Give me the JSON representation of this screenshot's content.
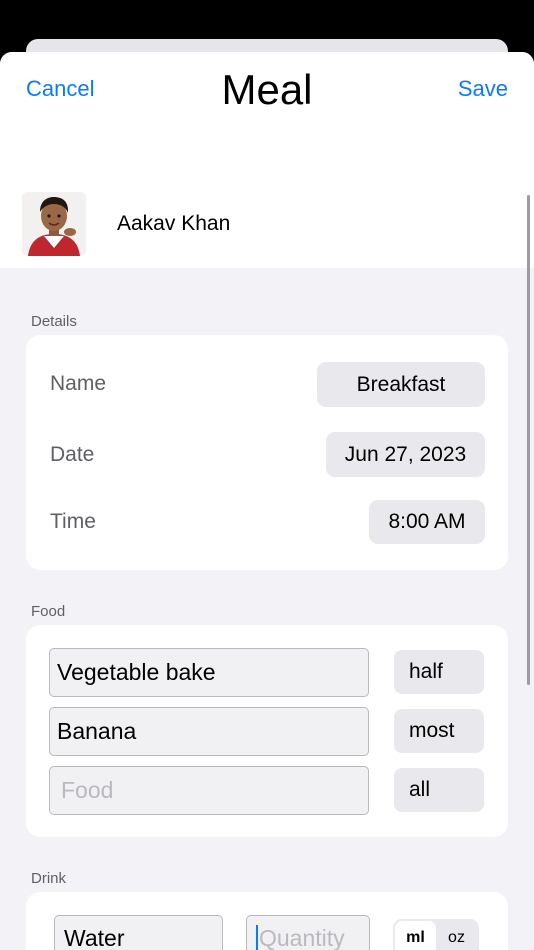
{
  "header": {
    "cancel_label": "Cancel",
    "title": "Meal",
    "save_label": "Save"
  },
  "person": {
    "name": "Aakav Khan"
  },
  "details": {
    "section_label": "Details",
    "name_label": "Name",
    "name_value": "Breakfast",
    "date_label": "Date",
    "date_value": "Jun 27, 2023",
    "time_label": "Time",
    "time_value": "8:00 AM"
  },
  "food": {
    "section_label": "Food",
    "items": [
      {
        "name": "Vegetable bake",
        "amount": "half"
      },
      {
        "name": "Banana",
        "amount": "most"
      }
    ],
    "new_item_placeholder": "Food",
    "new_item_amount": "all"
  },
  "drink": {
    "section_label": "Drink",
    "name": "Water",
    "quantity_placeholder": "Quantity",
    "units": [
      "ml",
      "oz"
    ],
    "selected_unit": "ml"
  },
  "colors": {
    "accent": "#0a7aff",
    "background": "#f2f2f7"
  }
}
